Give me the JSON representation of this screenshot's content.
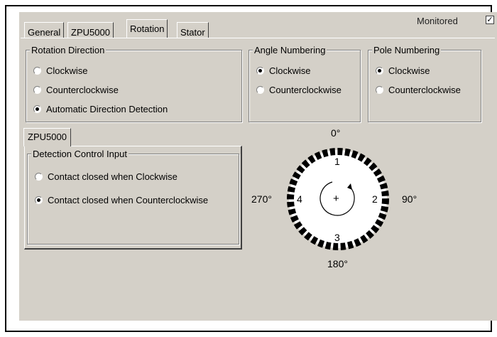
{
  "tabs": [
    "General",
    "ZPU5000",
    "Rotation",
    "Stator"
  ],
  "active_tab": "Rotation",
  "monitored": {
    "label": "Monitored",
    "checked": true
  },
  "rotation_direction": {
    "title": "Rotation Direction",
    "options": [
      "Clockwise",
      "Counterclockwise",
      "Automatic Direction Detection"
    ],
    "selected": "Automatic Direction Detection"
  },
  "angle_numbering": {
    "title": "Angle Numbering",
    "options": [
      "Clockwise",
      "Counterclockwise"
    ],
    "selected": "Clockwise"
  },
  "pole_numbering": {
    "title": "Pole Numbering",
    "options": [
      "Clockwise",
      "Counterclockwise"
    ],
    "selected": "Clockwise"
  },
  "inner_tab": "ZPU5000",
  "detection_control": {
    "title": "Detection Control Input",
    "options": [
      "Contact closed when Clockwise",
      "Contact closed when Counterclockwise"
    ],
    "selected": "Contact closed when Counterclockwise"
  },
  "diagram": {
    "angles": {
      "top": "0°",
      "right": "90°",
      "bottom": "180°",
      "left": "270°"
    },
    "poles": {
      "top": "1",
      "right": "2",
      "bottom": "3",
      "left": "4"
    },
    "center": "+"
  }
}
